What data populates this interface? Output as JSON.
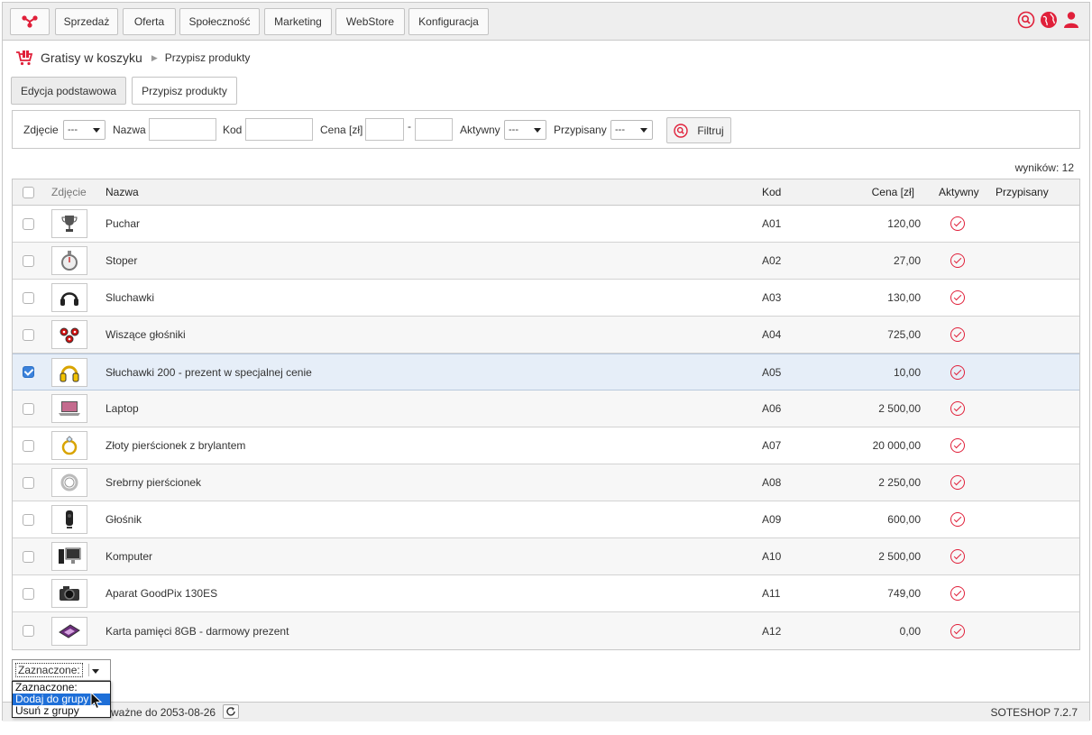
{
  "nav": {
    "items": [
      "Sprzedaż",
      "Oferta",
      "Społeczność",
      "Marketing",
      "WebStore",
      "Konfiguracja"
    ],
    "right_icons": [
      "search-icon",
      "globe-icon",
      "user-icon"
    ],
    "accent": "#e0203a"
  },
  "breadcrumb": {
    "main": "Gratisy w koszyku",
    "sub": "Przypisz produkty"
  },
  "tabs": [
    {
      "label": "Edycja podstawowa",
      "active": false
    },
    {
      "label": "Przypisz produkty",
      "active": true
    }
  ],
  "filter": {
    "photo_label": "Zdjęcie",
    "photo_value": "---",
    "name_label": "Nazwa",
    "code_label": "Kod",
    "price_label": "Cena [zł]",
    "price_sep": "-",
    "active_label": "Aktywny",
    "active_value": "---",
    "assigned_label": "Przypisany",
    "assigned_value": "---",
    "button_label": "Filtruj"
  },
  "results": "wyników: 12",
  "table": {
    "headers": {
      "photo": "Zdjęcie",
      "name": "Nazwa",
      "code": "Kod",
      "price": "Cena [zł]",
      "active": "Aktywny",
      "assigned": "Przypisany"
    },
    "rows": [
      {
        "name": "Puchar",
        "code": "A01",
        "price": "120,00",
        "checked": false,
        "thumb": "trophy"
      },
      {
        "name": "Stoper",
        "code": "A02",
        "price": "27,00",
        "checked": false,
        "thumb": "stopwatch"
      },
      {
        "name": "Sluchawki",
        "code": "A03",
        "price": "130,00",
        "checked": false,
        "thumb": "headphones"
      },
      {
        "name": "Wiszące głośniki",
        "code": "A04",
        "price": "725,00",
        "checked": false,
        "thumb": "speakers"
      },
      {
        "name": "Słuchawki 200 - prezent w specjalnej cenie",
        "code": "A05",
        "price": "10,00",
        "checked": true,
        "thumb": "headphones-yellow"
      },
      {
        "name": "Laptop",
        "code": "A06",
        "price": "2 500,00",
        "checked": false,
        "thumb": "laptop"
      },
      {
        "name": "Złoty pierścionek z brylantem",
        "code": "A07",
        "price": "20 000,00",
        "checked": false,
        "thumb": "gold-ring"
      },
      {
        "name": "Srebrny pierścionek",
        "code": "A08",
        "price": "2 250,00",
        "checked": false,
        "thumb": "silver-ring"
      },
      {
        "name": "Głośnik",
        "code": "A09",
        "price": "600,00",
        "checked": false,
        "thumb": "speaker"
      },
      {
        "name": "Komputer",
        "code": "A10",
        "price": "2 500,00",
        "checked": false,
        "thumb": "computer"
      },
      {
        "name": "Aparat GoodPix 130ES",
        "code": "A11",
        "price": "749,00",
        "checked": false,
        "thumb": "camera"
      },
      {
        "name": "Karta pamięci 8GB - darmowy prezent",
        "code": "A12",
        "price": "0,00",
        "checked": false,
        "thumb": "memory-card"
      }
    ]
  },
  "bulk": {
    "value": "Zaznaczone:",
    "options": [
      "Zaznaczone:",
      "Dodaj do grupy",
      "Usuń z grupy"
    ],
    "highlighted": 1
  },
  "footer": {
    "license": "ważne do 2053-08-26",
    "version": "SOTESHOP 7.2.7"
  }
}
